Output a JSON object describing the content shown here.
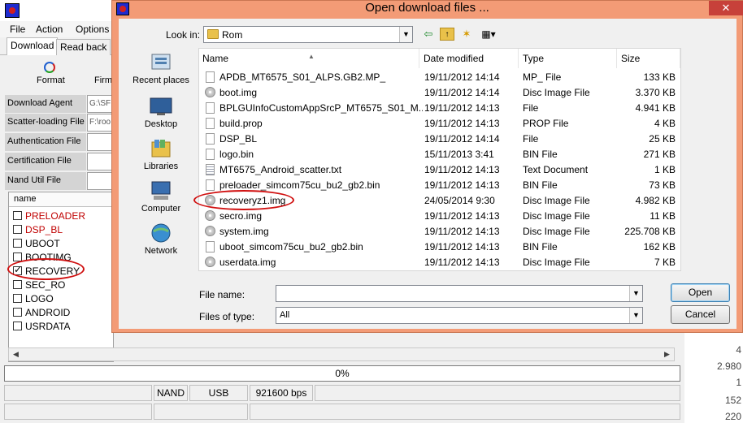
{
  "app": {
    "menu": [
      "File",
      "Action",
      "Options"
    ],
    "tabs": [
      "Download",
      "Read back"
    ],
    "toolbar": {
      "format_label": "Format",
      "firmware_label": "Firm"
    },
    "fields": [
      {
        "label": "Download Agent",
        "value": "G:\\SF"
      },
      {
        "label": "Scatter-loading File",
        "value": "F:\\roo"
      },
      {
        "label": "Authentication File",
        "value": ""
      },
      {
        "label": "Certification File",
        "value": ""
      },
      {
        "label": "Nand Util File",
        "value": ""
      }
    ],
    "list_header": "name",
    "partitions": [
      {
        "name": "PRELOADER",
        "checked": false,
        "color": "#c00000"
      },
      {
        "name": "DSP_BL",
        "checked": false,
        "color": "#c00000"
      },
      {
        "name": "UBOOT",
        "checked": false,
        "color": "#000000"
      },
      {
        "name": "BOOTIMG",
        "checked": false,
        "color": "#000000"
      },
      {
        "name": "RECOVERY",
        "checked": true,
        "color": "#000000"
      },
      {
        "name": "SEC_RO",
        "checked": false,
        "color": "#000000"
      },
      {
        "name": "LOGO",
        "checked": false,
        "color": "#000000"
      },
      {
        "name": "ANDROID",
        "checked": false,
        "color": "#000000"
      },
      {
        "name": "USRDATA",
        "checked": false,
        "color": "#000000"
      }
    ],
    "progress": {
      "text": "0%",
      "value": 0
    },
    "status": {
      "storage": "NAND",
      "port": "USB",
      "baud": "921600 bps"
    },
    "side_numbers": [
      "4",
      "2.980",
      "1",
      "152",
      "220"
    ]
  },
  "dialog": {
    "title": "Open download files ...",
    "close_symbol": "✕",
    "lookin_label": "Look in:",
    "lookin_value": "Rom",
    "places": [
      "Recent places",
      "Desktop",
      "Libraries",
      "Computer",
      "Network"
    ],
    "columns": {
      "name": "Name",
      "date": "Date modified",
      "type": "Type",
      "size": "Size"
    },
    "files": [
      {
        "name": "APDB_MT6575_S01_ALPS.GB2.MP_",
        "date": "19/11/2012 14:14",
        "type": "MP_ File",
        "size": "133 KB",
        "icon": "file"
      },
      {
        "name": "boot.img",
        "date": "19/11/2012 14:14",
        "type": "Disc Image File",
        "size": "3.370 KB",
        "icon": "disc"
      },
      {
        "name": "BPLGUInfoCustomAppSrcP_MT6575_S01_M...",
        "date": "19/11/2012 14:13",
        "type": "File",
        "size": "4.941 KB",
        "icon": "file"
      },
      {
        "name": "build.prop",
        "date": "19/11/2012 14:13",
        "type": "PROP File",
        "size": "4 KB",
        "icon": "file"
      },
      {
        "name": "DSP_BL",
        "date": "19/11/2012 14:14",
        "type": "File",
        "size": "25 KB",
        "icon": "file"
      },
      {
        "name": "logo.bin",
        "date": "15/11/2013 3:41",
        "type": "BIN File",
        "size": "271 KB",
        "icon": "file"
      },
      {
        "name": "MT6575_Android_scatter.txt",
        "date": "19/11/2012 14:13",
        "type": "Text Document",
        "size": "1 KB",
        "icon": "text"
      },
      {
        "name": "preloader_simcom75cu_bu2_gb2.bin",
        "date": "19/11/2012 14:13",
        "type": "BIN File",
        "size": "73 KB",
        "icon": "file"
      },
      {
        "name": "recoveryz1.img",
        "date": "24/05/2014 9:30",
        "type": "Disc Image File",
        "size": "4.982 KB",
        "icon": "disc"
      },
      {
        "name": "secro.img",
        "date": "19/11/2012 14:13",
        "type": "Disc Image File",
        "size": "11 KB",
        "icon": "disc"
      },
      {
        "name": "system.img",
        "date": "19/11/2012 14:13",
        "type": "Disc Image File",
        "size": "225.708 KB",
        "icon": "disc"
      },
      {
        "name": "uboot_simcom75cu_bu2_gb2.bin",
        "date": "19/11/2012 14:13",
        "type": "BIN File",
        "size": "162 KB",
        "icon": "file"
      },
      {
        "name": "userdata.img",
        "date": "19/11/2012 14:13",
        "type": "Disc Image File",
        "size": "7 KB",
        "icon": "disc"
      }
    ],
    "filename_label": "File name:",
    "filename_value": "",
    "filetype_label": "Files of type:",
    "filetype_value": "All",
    "open_label": "Open",
    "cancel_label": "Cancel"
  },
  "colors": {
    "dialog_frame": "#f39b76",
    "annotation": "#d01010",
    "close_button": "#c7413a"
  }
}
